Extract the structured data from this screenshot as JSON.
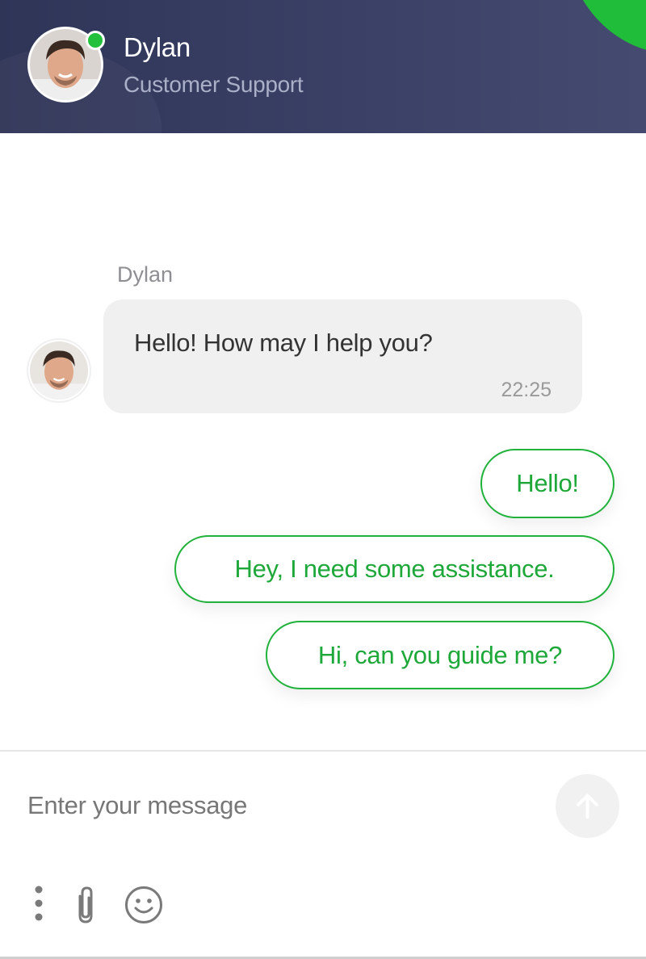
{
  "header": {
    "agent_name": "Dylan",
    "agent_role": "Customer Support",
    "online": true,
    "accent_color": "#22c03b",
    "background_color": "#3b4166"
  },
  "messages": [
    {
      "sender": "Dylan",
      "text": "Hello! How may I help you?",
      "time": "22:25"
    }
  ],
  "quick_replies": [
    "Hello!",
    "Hey, I need some assistance.",
    "Hi, can you guide me?"
  ],
  "composer": {
    "placeholder": "Enter your message",
    "send_icon": "arrow-up-icon",
    "tools": [
      "more-options-icon",
      "paperclip-icon",
      "smiley-icon"
    ]
  }
}
